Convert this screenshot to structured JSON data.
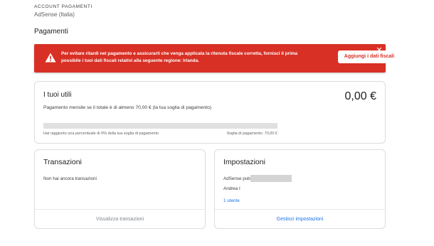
{
  "header": {
    "section_label": "ACCOUNT PAGAMENTI",
    "account_name": "AdSense (Italia)",
    "page_title": "Pagamenti"
  },
  "alert": {
    "text": "Per evitare ritardi nel pagamento e assicurarti che venga applicata la ritenuta fiscale corretta, fornisci il prima possibile i tuoi dati fiscali relativi alla seguente regione: Irlanda.",
    "button_label": "Aggiungi i dati fiscali",
    "close_glyph": "✕",
    "color": "#d93025"
  },
  "earnings": {
    "title": "I tuoi utili",
    "amount": "0,00 €",
    "threshold_text": "Pagamento mensile se il totale è di almeno 70,00 € (la tua soglia di pagamento)",
    "progress_fraction": 0,
    "progress_label": "Hai raggiunto una percentuale di 0% della tua soglia di pagamento",
    "threshold_label": "Soglia di pagamento: 70,00 €"
  },
  "transactions": {
    "title": "Transazioni",
    "empty_text": "Non hai ancora transazioni",
    "footer_link": "Visualizza transazioni"
  },
  "settings": {
    "title": "Impostazioni",
    "publisher_label": "AdSense pub",
    "user_name": "Andrea I",
    "users_link": "1 utente",
    "footer_link": "Gestisci impostazioni"
  }
}
